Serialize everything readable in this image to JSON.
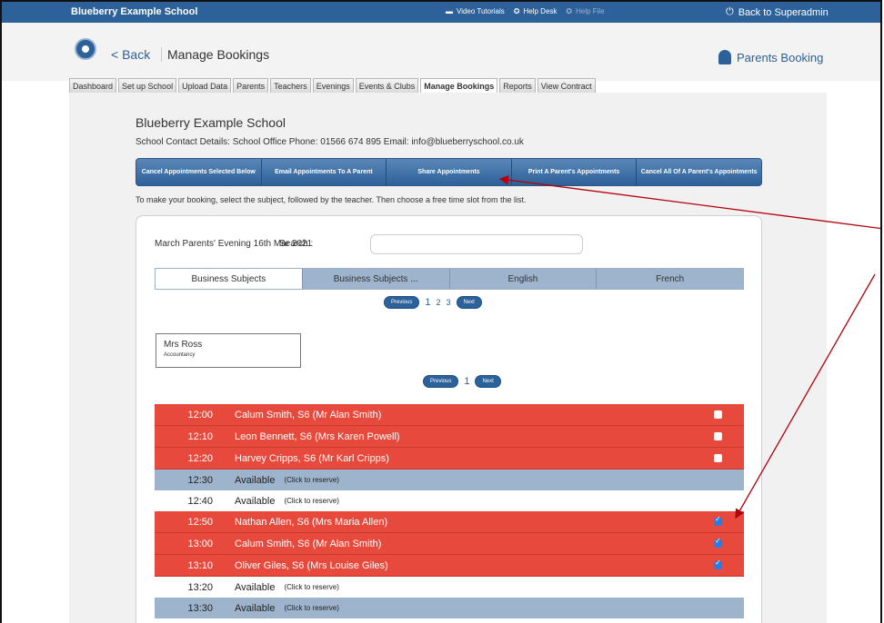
{
  "topbar": {
    "school_name": "Blueberry Example School",
    "video_tutorials": "Video Tutorials",
    "help_desk": "Help Desk",
    "help_file": "Help File",
    "back_superadmin": "Back to Superadmin"
  },
  "header": {
    "back_label": "< Back",
    "page_title": "Manage Bookings",
    "brand": "Parents Booking"
  },
  "tabs": [
    "Dashboard",
    "Set up School",
    "Upload Data",
    "Parents",
    "Teachers",
    "Evenings",
    "Events & Clubs",
    "Manage Bookings",
    "Reports",
    "View Contract"
  ],
  "school": {
    "name": "Blueberry Example School",
    "contact": "School Contact Details: School Office   Phone: 01566 674 895   Email: info@blueberryschool.co.uk"
  },
  "actions": {
    "cancel_selected": "Cancel Appointments Selected Below",
    "email_parent": "Email Appointments To A Parent",
    "share": "Share Appointments",
    "print_parent": "Print A Parent's Appointments",
    "cancel_all": "Cancel All Of A Parent's Appointments"
  },
  "instructions": "To make your booking, select the subject, followed by the teacher. Then choose a free time slot from the list.",
  "evening": {
    "name": "March Parents' Evening 16th Mar 2021",
    "search_label": "Search :"
  },
  "subjects": [
    "Business Subjects",
    "Business Subjects ...",
    "English",
    "French"
  ],
  "pager_subjects": {
    "prev": "Previous",
    "pages": [
      "1",
      "2",
      "3"
    ],
    "next": "Next"
  },
  "teacher": {
    "name": "Mrs Ross",
    "subject": "Accountancy"
  },
  "pager_teacher": {
    "prev": "Previous",
    "page": "1",
    "next": "Next"
  },
  "slots": [
    {
      "time": "12:00",
      "text": "Calum Smith, S6 (Mr Alan Smith)",
      "checked": false
    },
    {
      "time": "12:10",
      "text": "Leon Bennett, S6 (Mrs Karen Powell)",
      "checked": false
    },
    {
      "time": "12:20",
      "text": "Harvey Cripps, S6 (Mr Karl Cripps)",
      "checked": false
    },
    {
      "time": "12:30",
      "text": "Available",
      "reserve": "(Click to reserve)"
    },
    {
      "time": "12:40",
      "text": "Available",
      "reserve": "(Click to reserve)"
    },
    {
      "time": "12:50",
      "text": "Nathan Allen, S6 (Mrs Maria Allen)",
      "checked": true
    },
    {
      "time": "13:00",
      "text": "Calum Smith, S6 (Mr Alan Smith)",
      "checked": true
    },
    {
      "time": "13:10",
      "text": "Oliver Giles, S6 (Mrs Louise Giles)",
      "checked": true
    },
    {
      "time": "13:20",
      "text": "Available",
      "reserve": "(Click to reserve)"
    },
    {
      "time": "13:30",
      "text": "Available",
      "reserve": "(Click to reserve)"
    }
  ],
  "colors": {
    "brand": "#2d6199",
    "booked": "#e74a3c",
    "available": "#9eb4cc",
    "annotation": "#b3000a"
  }
}
